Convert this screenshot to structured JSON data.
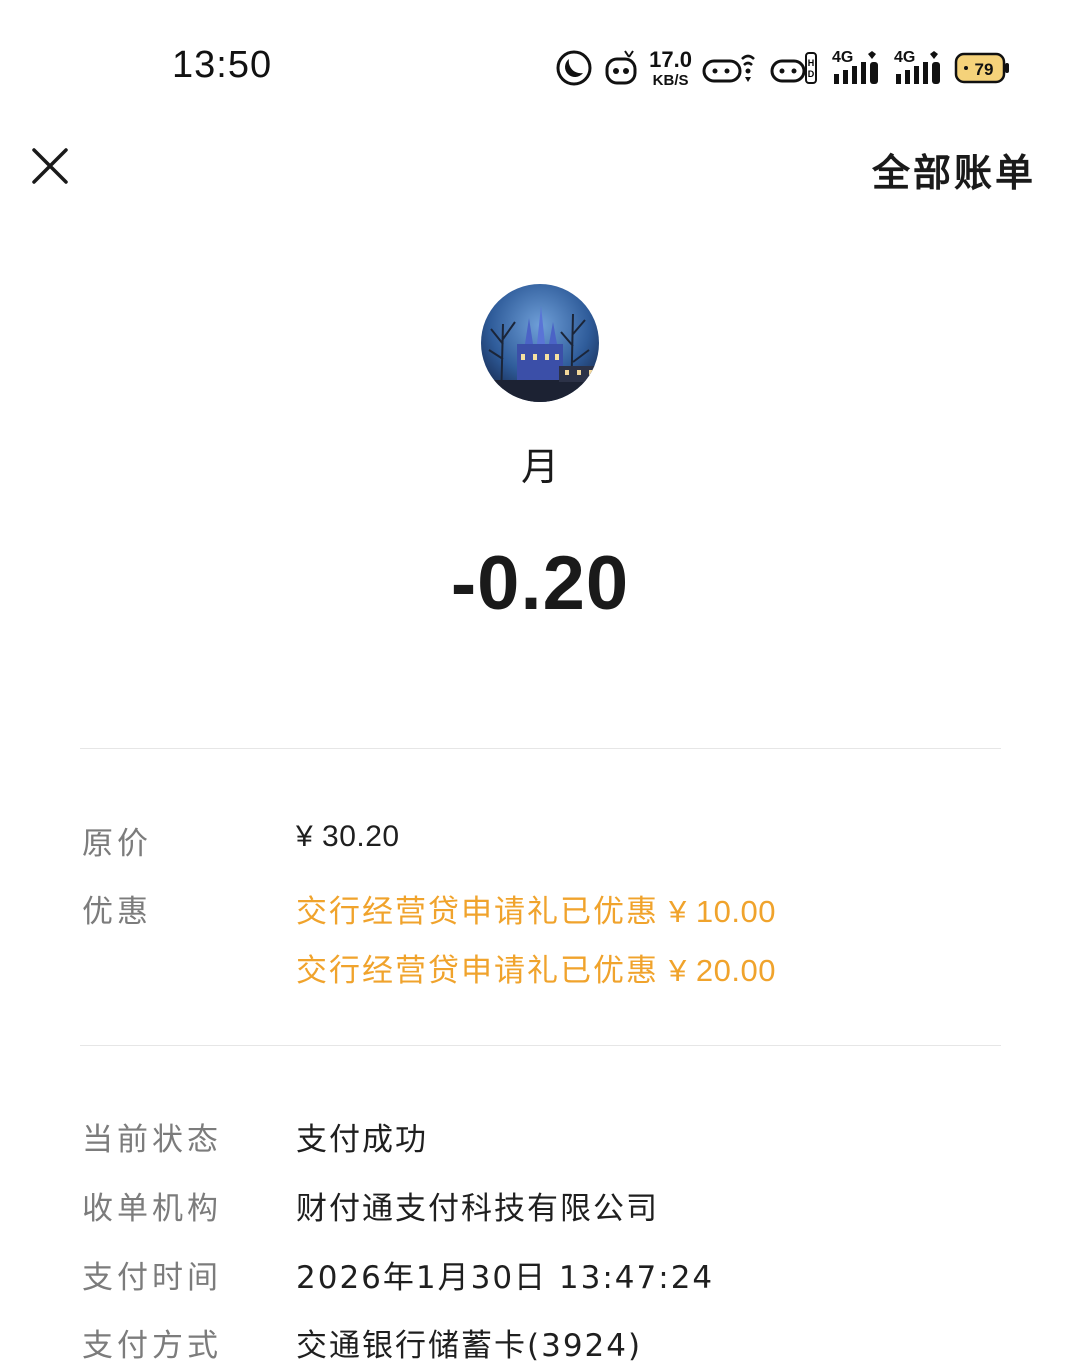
{
  "status_bar": {
    "time": "13:50",
    "net_speed_value": "17.0",
    "net_speed_unit": "KB/S",
    "sim1_label": "4G",
    "sim2_label": "4G",
    "battery_level": "79"
  },
  "topbar": {
    "all_bills_label": "全部账单"
  },
  "header": {
    "merchant_name": "月",
    "amount": "-0.20"
  },
  "details": {
    "original_price": {
      "label": "原价",
      "value": "¥ 30.20"
    },
    "discounts": {
      "label": "优惠",
      "items": [
        {
          "text": "交行经营贷申请礼已优惠",
          "amount": "¥ 10.00"
        },
        {
          "text": "交行经营贷申请礼已优惠",
          "amount": "¥ 20.00"
        }
      ]
    },
    "status": {
      "label": "当前状态",
      "value": "支付成功"
    },
    "acquirer": {
      "label": "收单机构",
      "value": "财付通支付科技有限公司"
    },
    "pay_time": {
      "label": "支付时间",
      "value": "2026年1月30日 13:47:24"
    },
    "pay_method": {
      "label": "支付方式",
      "value": "交通银行储蓄卡(3924)"
    }
  },
  "colors": {
    "discount": "#f0a32c",
    "label": "#7c7c7c",
    "text": "#1f1f1f"
  }
}
